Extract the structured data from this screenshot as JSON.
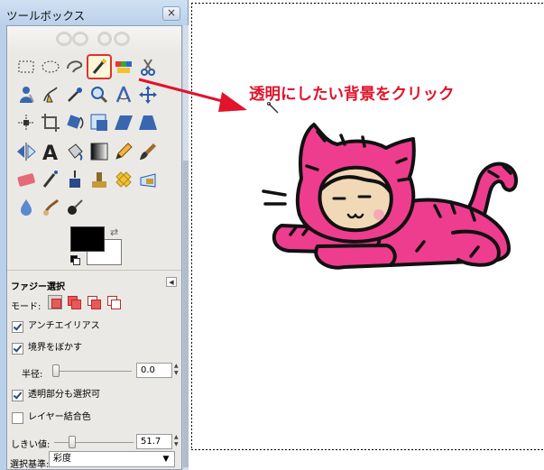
{
  "toolbox": {
    "title": "ツールボックス",
    "close_glyph": "×",
    "tools": [
      {
        "icon": "rect-select-icon"
      },
      {
        "icon": "ellipse-select-icon"
      },
      {
        "icon": "free-select-icon"
      },
      {
        "icon": "fuzzy-select-icon",
        "selected": true
      },
      {
        "icon": "color-select-icon"
      },
      {
        "icon": "scissors-select-icon"
      },
      {
        "icon": "foreground-select-icon"
      },
      {
        "icon": "paths-icon"
      },
      {
        "icon": "color-picker-icon"
      },
      {
        "icon": "zoom-icon"
      },
      {
        "icon": "measure-icon"
      },
      {
        "icon": "move-icon"
      },
      {
        "icon": "align-icon"
      },
      {
        "icon": "crop-icon"
      },
      {
        "icon": "rotate-icon"
      },
      {
        "icon": "scale-icon"
      },
      {
        "icon": "shear-icon"
      },
      {
        "icon": "perspective-icon"
      },
      {
        "icon": "flip-icon"
      },
      {
        "icon": "text-icon"
      },
      {
        "icon": "bucket-fill-icon"
      },
      {
        "icon": "blend-icon"
      },
      {
        "icon": "pencil-icon"
      },
      {
        "icon": "paintbrush-icon"
      },
      {
        "icon": "eraser-icon"
      },
      {
        "icon": "airbrush-icon"
      },
      {
        "icon": "ink-icon"
      },
      {
        "icon": "clone-icon"
      },
      {
        "icon": "heal-icon"
      },
      {
        "icon": "perspective-clone-icon"
      },
      {
        "icon": "blur-icon"
      },
      {
        "icon": "smudge-icon"
      },
      {
        "icon": "dodge-burn-icon"
      }
    ],
    "colors": {
      "foreground": "#000000",
      "background": "#ffffff",
      "swap_glyph": "⇄"
    },
    "options": {
      "title": "ファジー選択",
      "mode_label": "モード:",
      "antialias": {
        "label": "アンチエイリアス",
        "checked": true
      },
      "feather": {
        "label": "境界をぼかす",
        "checked": true
      },
      "radius": {
        "label": "半径:",
        "value": "0.0",
        "fraction": 0.0
      },
      "transparent": {
        "label": "透明部分も選択可",
        "checked": true
      },
      "merged": {
        "label": "レイヤー結合色",
        "checked": false
      },
      "threshold": {
        "label": "しきい値:",
        "value": "51.7",
        "fraction": 0.2
      },
      "select_by": {
        "label": "選択基準:",
        "value": "彩度"
      }
    }
  },
  "canvas": {
    "callout": "透明にしたい背景をクリック",
    "accent_color": "#e0142b",
    "cat_color": "#ee3d8e"
  }
}
